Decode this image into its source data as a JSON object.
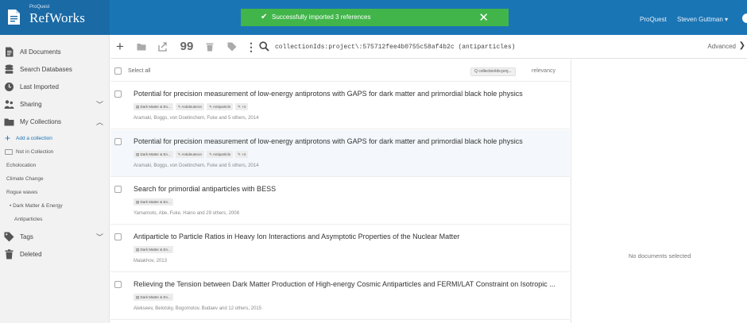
{
  "header": {
    "brand_small": "ProQuest",
    "brand_big": "RefWorks",
    "toast": "Successfully imported 3 references",
    "proquest_link": "ProQuest",
    "user": "Steven Guttman ▾"
  },
  "sidebar": {
    "items": [
      {
        "label": "All Documents",
        "icon": "document-icon"
      },
      {
        "label": "Search Databases",
        "icon": "database-icon"
      },
      {
        "label": "Last Imported",
        "icon": "clock-icon"
      },
      {
        "label": "Sharing",
        "icon": "people-icon"
      },
      {
        "label": "My Collections",
        "icon": "folder-icon"
      },
      {
        "label": "Tags",
        "icon": "tag-icon"
      },
      {
        "label": "Deleted",
        "icon": "trash-icon"
      }
    ],
    "collections": [
      "Add a collection",
      "Not in Collection",
      "Echolocation",
      "Climate Change",
      "Rogue waves",
      "• Dark Matter & Energy",
      "Antiparticles"
    ]
  },
  "toolbar": {
    "search_query": "collectionIds:project\\:575712fee4b0755c58af4b2c (antiparticles)",
    "advanced": "Advanced",
    "advanced_arrow": "❯"
  },
  "results": {
    "select_all": "Select all",
    "search_pill": "Q collectionIds:proj...",
    "sort": "relevancy",
    "rows": [
      {
        "title": "Potential for precision measurement of low-energy antiprotons with GAPS for dark matter and primordial black hole physics",
        "tags": [
          "▤ Dark Matter & En...",
          "✎ Antideuteron",
          "✎ Antiparticle",
          "✎ +4"
        ],
        "authors": "Aramaki, Boggs, von Doetinchem, Fuke and 5 others, 2014"
      },
      {
        "title": "Potential for precision measurement of low-energy antiprotons with GAPS for dark matter and primordial black hole physics",
        "tags": [
          "▤ Dark Matter & En...",
          "✎ Antideuteron",
          "✎ Antiparticle",
          "✎ +4"
        ],
        "authors": "Aramaki, Boggs, von Doetinchem, Fuke and 5 others, 2014"
      },
      {
        "title": "Search for primordial antiparticles with BESS",
        "tags": [
          "▤ Dark Matter & En..."
        ],
        "authors": "Yamamoto, Abe, Fuke, Haino and 29 others, 2008"
      },
      {
        "title": "Antiparticle to Particle Ratios in Heavy Ion Interactions and Asymptotic Properties of the Nuclear Matter",
        "tags": [
          "▤ Dark Matter & En..."
        ],
        "authors": "Malakhov, 2013"
      },
      {
        "title": "Relieving the Tension between Dark Matter Production of High-energy Cosmic Antiparticles and FERMI/LAT Constraint on Isotropic ...",
        "tags": [
          "▤ Dark Matter & En..."
        ],
        "authors": "Alekseev, Belotsky, Bogomolov, Budaev and 12 others, 2015"
      }
    ]
  },
  "detail": {
    "empty_text": "No documents selected"
  },
  "colors": {
    "header_blue": "#1a75b5",
    "toast_green": "#41b54a"
  }
}
